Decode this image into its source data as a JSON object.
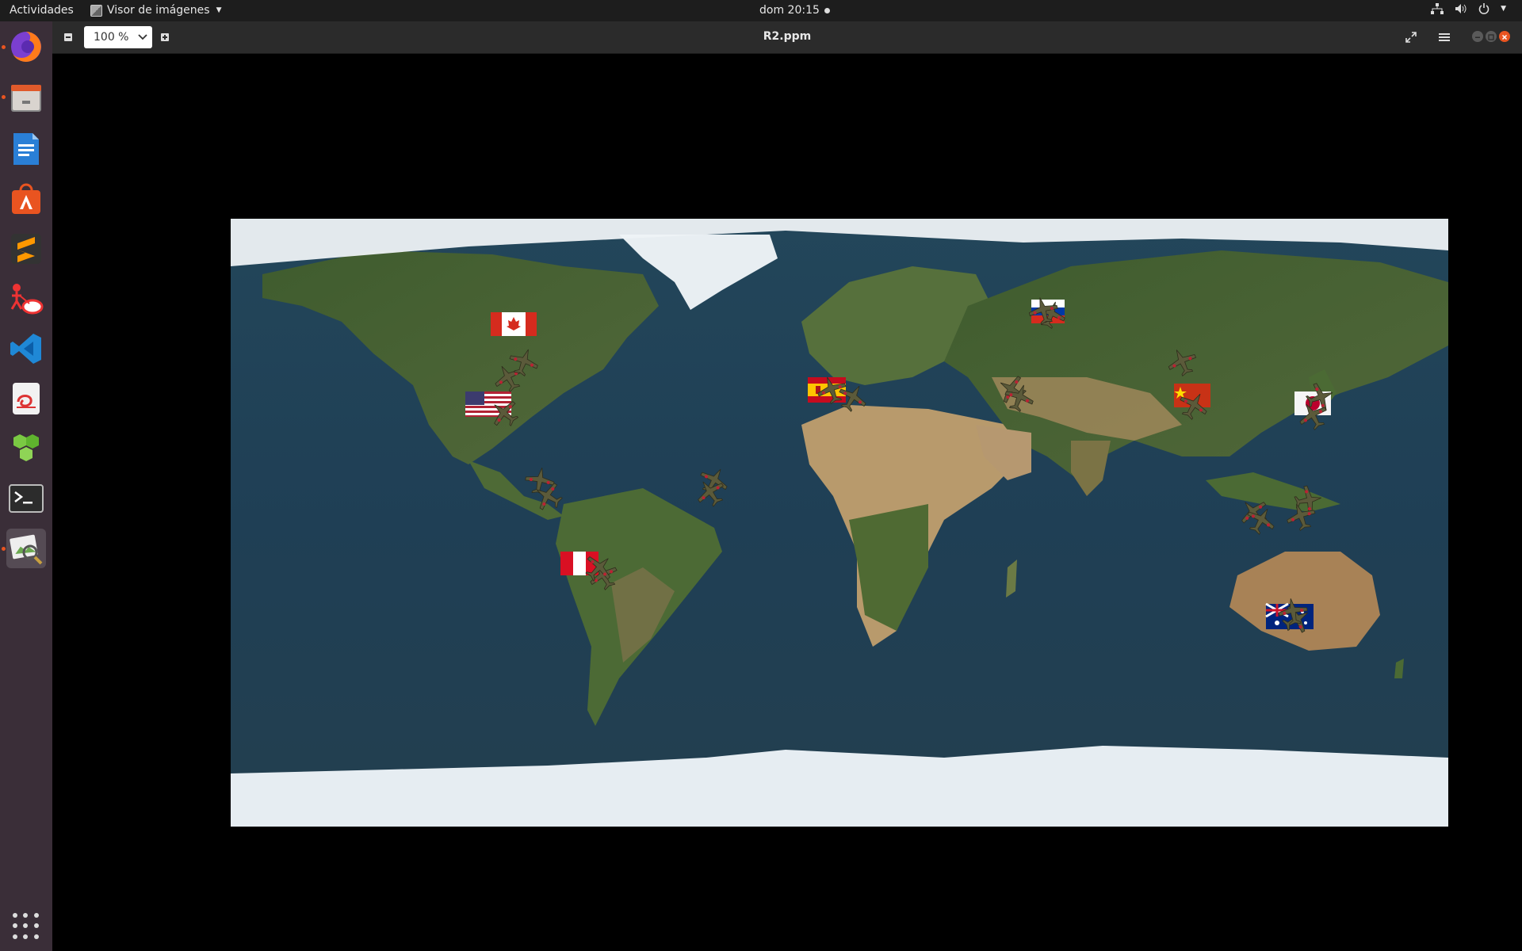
{
  "topbar": {
    "activities": "Actividades",
    "app_name": "Visor de imágenes",
    "clock": "dom 20:15",
    "network_icon": "network-icon",
    "volume_icon": "volume-icon",
    "power_icon": "power-icon"
  },
  "dock": {
    "items": [
      {
        "name": "firefox",
        "icon": "firefox-icon"
      },
      {
        "name": "files",
        "icon": "files-icon"
      },
      {
        "name": "libreoffice-writer",
        "icon": "writer-icon"
      },
      {
        "name": "software",
        "icon": "software-icon"
      },
      {
        "name": "sublime-text",
        "icon": "sublime-icon"
      },
      {
        "name": "app-red",
        "icon": "red-app-icon"
      },
      {
        "name": "vscode",
        "icon": "vscode-icon"
      },
      {
        "name": "document-viewer",
        "icon": "document-viewer-icon"
      },
      {
        "name": "app-green",
        "icon": "green-app-icon"
      },
      {
        "name": "terminal",
        "icon": "terminal-icon"
      },
      {
        "name": "image-viewer",
        "icon": "image-viewer-icon"
      }
    ],
    "show_apps_icon": "apps-grid-icon"
  },
  "viewer": {
    "zoom_value": "100 %",
    "window_title": "R2.ppm",
    "zoom_out_icon": "minus-icon",
    "zoom_in_icon": "plus-icon",
    "fullscreen_icon": "fullscreen-icon",
    "menu_icon": "hamburger-menu-icon"
  },
  "image": {
    "description_icon": "world-map-image",
    "flags": [
      "canada",
      "usa",
      "peru",
      "spain",
      "russia",
      "china",
      "japan",
      "australia"
    ]
  },
  "colors": {
    "accent": "#e95420",
    "dock_bg": "#3a2e38",
    "topbar_bg": "#1d1d1d",
    "header_bg": "#2b2b2b"
  }
}
